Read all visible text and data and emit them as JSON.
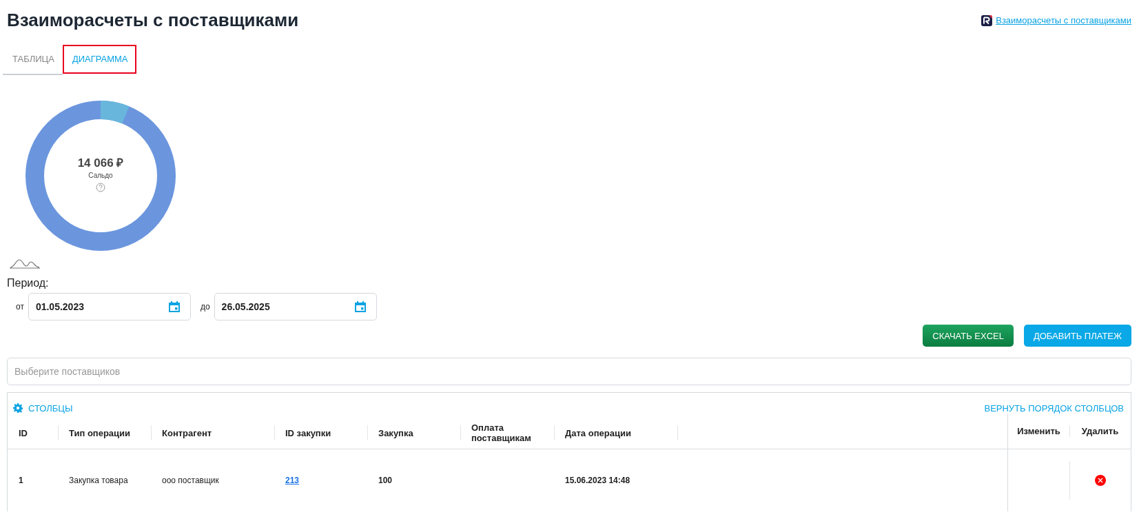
{
  "page": {
    "title": "Взаиморасчеты с поставщиками",
    "help_link": "Взаиморасчеты с поставщиками"
  },
  "tabs": [
    {
      "label": "ТАБЛИЦА",
      "selected": false,
      "highlighted": false
    },
    {
      "label": "ДИАГРАММА",
      "selected": true,
      "highlighted": true
    }
  ],
  "balance": {
    "amount": "14 066 ₽",
    "label": "Сальдо"
  },
  "period": {
    "label": "Период:",
    "from_label": "от",
    "from": "01.05.2023",
    "to_label": "до",
    "to": "26.05.2025"
  },
  "actions": [
    {
      "label": "СКАЧАТЬ EXCEL",
      "kind": "excel"
    },
    {
      "label": "ДОБАВИТЬ ПЛАТЕЖ",
      "kind": "primary"
    }
  ],
  "supplier_filter": {
    "placeholder": "Выберите поставщиков"
  },
  "table": {
    "columns_button": "СТОЛБЦЫ",
    "reset_button": "ВЕРНУТЬ ПОРЯДОК СТОЛБЦОВ",
    "columns": [
      "ID",
      "Тип операции",
      "Контрагент",
      "ID закупки",
      "Закупка",
      "Оплата поставщикам",
      "Дата операции"
    ],
    "action_columns": [
      "Изменить",
      "Удалить"
    ],
    "rows": [
      {
        "id": "1",
        "type": "Закупка товара",
        "counterparty": "ооо поставщик",
        "purchase_id": "213",
        "purchase": "100",
        "date": "15.06.2023 14:48",
        "deletable": true
      }
    ]
  }
}
